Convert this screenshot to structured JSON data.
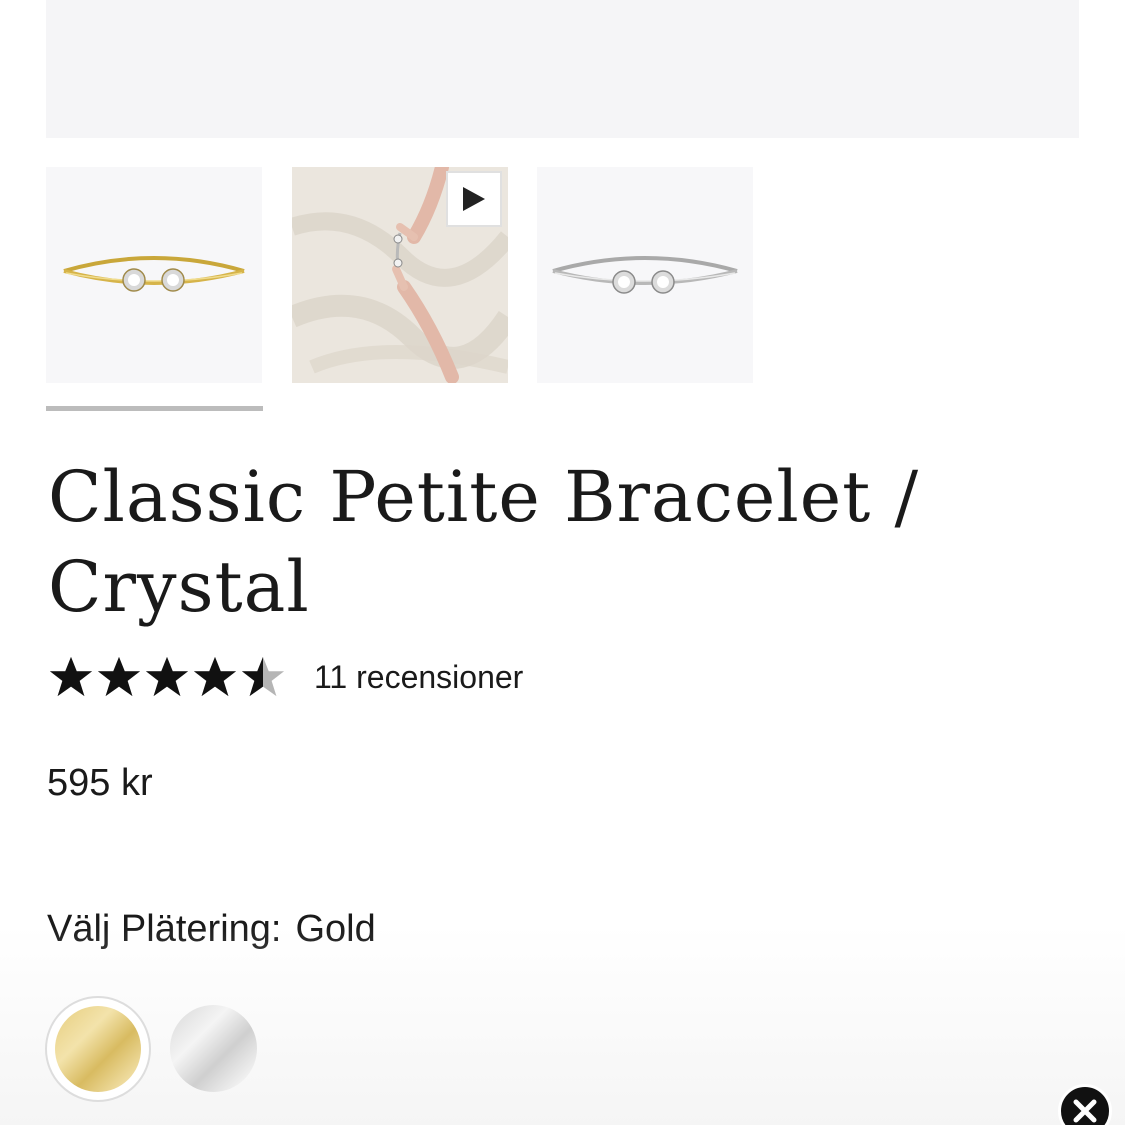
{
  "product": {
    "title_line1": "Classic Petite Bracelet /",
    "title_line2": "Crystal",
    "rating": 4.5,
    "rating_max": 5,
    "review_count_text": "11 recensioner",
    "price": "595 kr"
  },
  "gallery": {
    "active_index": 0,
    "thumbnails": [
      {
        "icon": "gold-bracelet-thumbnail",
        "is_video": false
      },
      {
        "icon": "video-thumbnail",
        "is_video": true
      },
      {
        "icon": "silver-bracelet-thumbnail",
        "is_video": false
      }
    ]
  },
  "plating": {
    "label": "Välj Plätering:",
    "selected": "Gold",
    "options": [
      "Gold",
      "Silver"
    ]
  },
  "colors": {
    "text": "#1a1a1a",
    "indicator": "#bcbcbc",
    "gold": "#e6cd7d",
    "silver": "#d7d7d7"
  }
}
